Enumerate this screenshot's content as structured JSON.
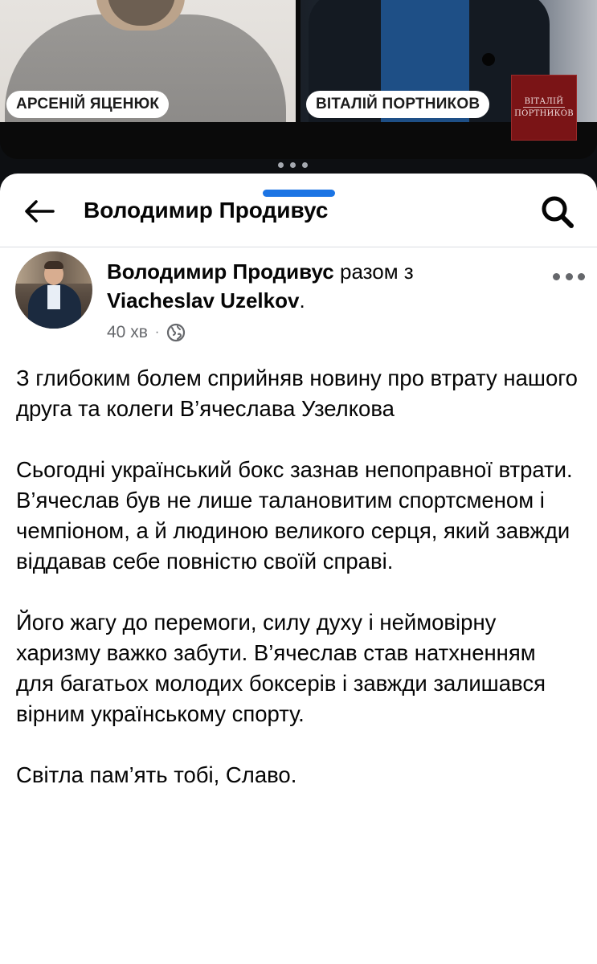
{
  "video": {
    "left_name": "АРСЕНІЙ ЯЦЕНЮК",
    "right_name": "ВІТАЛІЙ ПОРТНИКОВ",
    "logo_line1": "ВІТАЛІЙ",
    "logo_line2": "ПОРТНИКОВ",
    "logo_color": "#7a1416"
  },
  "header": {
    "title": "Володимир Продивус",
    "back_icon": "arrow-left-icon",
    "search_icon": "search-icon"
  },
  "post": {
    "author": "Володимир Продивус",
    "with_text": "разом з",
    "tagged": "Viacheslav Uzelkov",
    "tagged_suffix": ".",
    "time": "40 хв",
    "separator": "·",
    "audience_icon": "globe-icon",
    "more_icon": "more-horizontal-icon",
    "paragraphs": [
      "З глибоким болем сприйняв новину про втрату нашого друга та колеги В’ячеслава Узелкова",
      "Сьогодні український бокс зазнав непоправної втрати. В’ячеслав був не лише талановитим спортсменом і чемпіоном, а й людиною великого серця, який завжди віддавав себе повністю своїй справі.",
      "Його жагу до перемоги, силу духу і неймовірну харизму важко забути. В’ячеслав став натхненням для багатьох молодих боксерів і завжди залишався вірним українському спорту.",
      "Світла пам’ять тобі, Славо."
    ]
  },
  "colors": {
    "accent": "#1b74e4",
    "text": "#050505",
    "muted": "#65676b"
  }
}
